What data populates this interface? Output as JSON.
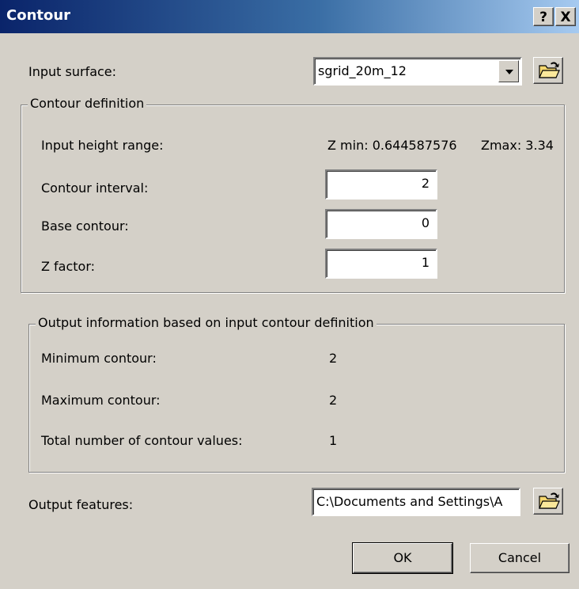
{
  "window": {
    "title": "Contour",
    "help_label": "?",
    "close_label": "X"
  },
  "input_surface": {
    "label": "Input surface:",
    "value": "sgrid_20m_12"
  },
  "contour_definition": {
    "legend": "Contour definition",
    "height_range_label": "Input height range:",
    "zmin_text": "Z min: 0.644587576",
    "zmax_text": "Zmax: 3.34",
    "interval_label": "Contour interval:",
    "interval_value": "2",
    "base_label": "Base contour:",
    "base_value": "0",
    "zfactor_label": "Z factor:",
    "zfactor_value": "1"
  },
  "output_info": {
    "legend": "Output information based on input contour definition",
    "min_label": "Minimum contour:",
    "min_value": "2",
    "max_label": "Maximum contour:",
    "max_value": "2",
    "total_label": "Total number of contour values:",
    "total_value": "1"
  },
  "output_features": {
    "label": "Output features:",
    "value": "C:\\Documents and Settings\\A"
  },
  "buttons": {
    "ok": "OK",
    "cancel": "Cancel"
  },
  "icons": {
    "browse": "open-folder-icon"
  }
}
